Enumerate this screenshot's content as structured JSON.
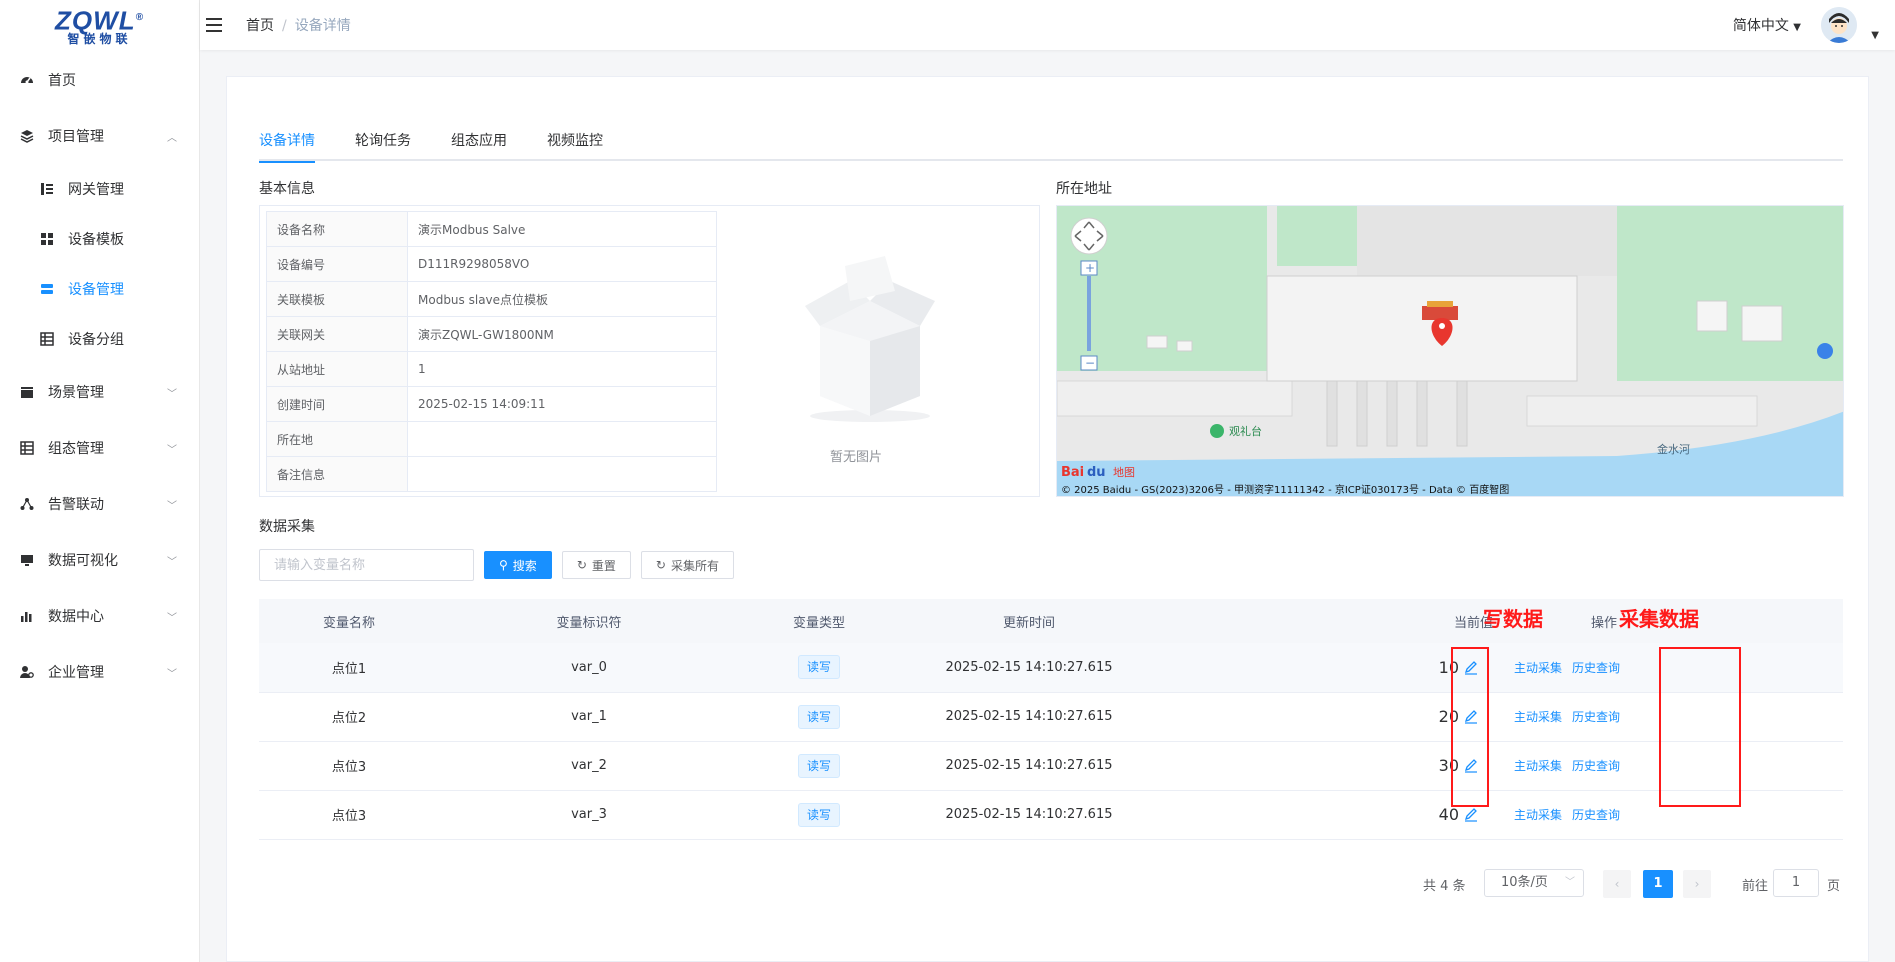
{
  "logo": {
    "brand": "ZQWL",
    "sub": "智嵌物联"
  },
  "sidebar": {
    "items": [
      {
        "label": "首页",
        "icon": "dashboard-icon"
      },
      {
        "label": "项目管理",
        "icon": "layers-icon",
        "expanded": true
      },
      {
        "label": "网关管理",
        "icon": "tree-list-icon"
      },
      {
        "label": "设备模板",
        "icon": "grid-icon"
      },
      {
        "label": "设备管理",
        "icon": "server-icon",
        "active": true
      },
      {
        "label": "设备分组",
        "icon": "list-icon"
      },
      {
        "label": "场景管理",
        "icon": "clapper-icon"
      },
      {
        "label": "组态管理",
        "icon": "list-icon"
      },
      {
        "label": "告警联动",
        "icon": "share-icon"
      },
      {
        "label": "数据可视化",
        "icon": "monitor-icon"
      },
      {
        "label": "数据中心",
        "icon": "bar-chart-icon"
      },
      {
        "label": "企业管理",
        "icon": "user-gear-icon"
      }
    ]
  },
  "header": {
    "breadcrumb": [
      "首页",
      "设备详情"
    ],
    "language": "简体中文"
  },
  "tabs": [
    "设备详情",
    "轮询任务",
    "组态应用",
    "视频监控"
  ],
  "basic_info": {
    "title": "基本信息",
    "rows": [
      {
        "key": "设备名称",
        "value": "演示Modbus Salve"
      },
      {
        "key": "设备编号",
        "value": "D111R9298058VO"
      },
      {
        "key": "关联模板",
        "value": "Modbus slave点位模板"
      },
      {
        "key": "关联网关",
        "value": "演示ZQWL-GW1800NM"
      },
      {
        "key": "从站地址",
        "value": "1"
      },
      {
        "key": "创建时间",
        "value": "2025-02-15 14:09:11"
      },
      {
        "key": "所在地",
        "value": ""
      },
      {
        "key": "备注信息",
        "value": ""
      }
    ],
    "no_image": "暂无图片"
  },
  "location": {
    "title": "所在地址",
    "labels": {
      "guanlitai": "观礼台",
      "jinshuihe": "金水河"
    },
    "copyright": "© 2025 Baidu - GS(2023)3206号 - 甲测资字11111342 - 京ICP证030173号 - Data © 百度智图"
  },
  "data_collect": {
    "title": "数据采集",
    "search_placeholder": "请输入变量名称",
    "search_label": "搜索",
    "reset_label": "重置",
    "collect_all_label": "采集所有",
    "columns": [
      "变量名称",
      "变量标识符",
      "变量类型",
      "更新时间",
      "当前值",
      "操作"
    ],
    "rows": [
      {
        "name": "点位1",
        "id": "var_0",
        "type": "读写",
        "time": "2025-02-15 14:10:27.615",
        "value": "10",
        "op1": "主动采集",
        "op2": "历史查询"
      },
      {
        "name": "点位2",
        "id": "var_1",
        "type": "读写",
        "time": "2025-02-15 14:10:27.615",
        "value": "20",
        "op1": "主动采集",
        "op2": "历史查询"
      },
      {
        "name": "点位3",
        "id": "var_2",
        "type": "读写",
        "time": "2025-02-15 14:10:27.615",
        "value": "30",
        "op1": "主动采集",
        "op2": "历史查询"
      },
      {
        "name": "点位3",
        "id": "var_3",
        "type": "读写",
        "time": "2025-02-15 14:10:27.615",
        "value": "40",
        "op1": "主动采集",
        "op2": "历史查询"
      }
    ]
  },
  "annotations": {
    "write": "写数据",
    "collect": "采集数据"
  },
  "pagination": {
    "total": "共 4 条",
    "page_size": "10条/页",
    "current_page": "1",
    "goto_prefix": "前往",
    "goto_value": "1",
    "goto_suffix": "页"
  },
  "colors": {
    "primary": "#1890ff",
    "annotation": "#ff1a1a"
  }
}
